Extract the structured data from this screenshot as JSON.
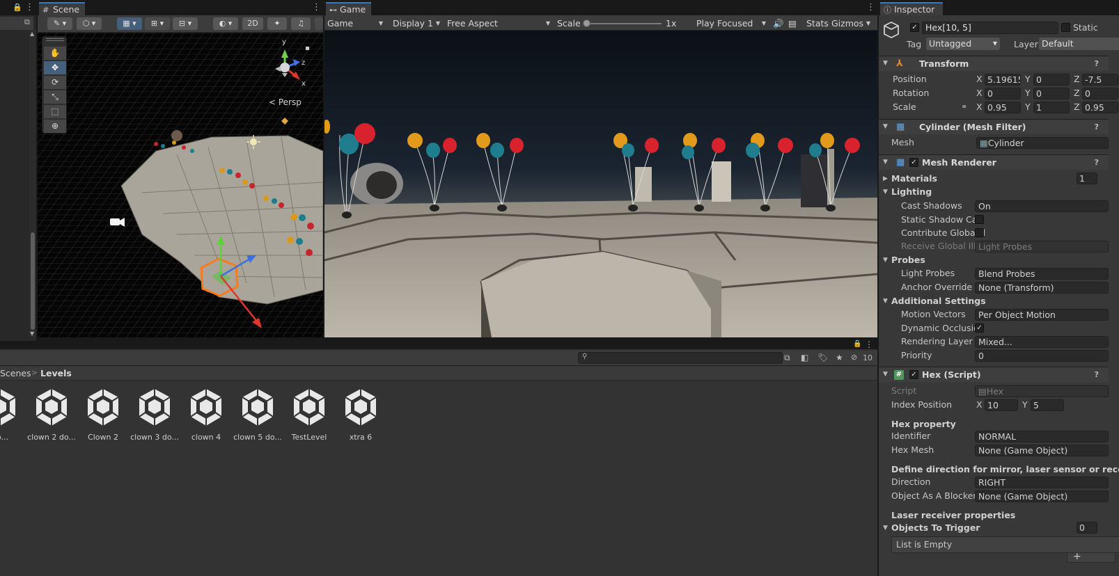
{
  "scene_tab": {
    "label": "Scene"
  },
  "game_tab": {
    "label": "Game"
  },
  "inspector_tab": {
    "label": "Inspector"
  },
  "scene_toolbar": {
    "mode_2d": "2D",
    "persp_label": "< Persp"
  },
  "gizmo_axes": {
    "x": "x",
    "y": "y",
    "z": "z"
  },
  "game_toolbar": {
    "display_mode": "Game",
    "display": "Display 1",
    "aspect": "Free Aspect",
    "scale_label": "Scale",
    "scale_value": "1x",
    "scale_fraction": 0.0,
    "play_mode": "Play Focused",
    "stats": "Stats",
    "gizmos": "Gizmos"
  },
  "project": {
    "breadcrumb": {
      "parent": "Scenes",
      "sep": ">",
      "current": "Levels"
    },
    "hidden_count": "10",
    "assets": [
      {
        "name": "do..."
      },
      {
        "name": "clown 2 do..."
      },
      {
        "name": "Clown 2"
      },
      {
        "name": "clown 3 do..."
      },
      {
        "name": "clown 4"
      },
      {
        "name": "clown 5 do..."
      },
      {
        "name": "TestLevel"
      },
      {
        "name": "xtra 6"
      }
    ]
  },
  "inspector": {
    "object_name": "Hex[10, 5]",
    "static_label": "Static",
    "tag_label": "Tag",
    "tag_value": "Untagged",
    "layer_label": "Layer",
    "layer_value": "Default",
    "transform": {
      "title": "Transform",
      "position": {
        "label": "Position",
        "x": "5.19615",
        "y": "0",
        "z": "-7.5"
      },
      "rotation": {
        "label": "Rotation",
        "x": "0",
        "y": "0",
        "z": "0"
      },
      "scale": {
        "label": "Scale",
        "x": "0.95",
        "y": "1",
        "z": "0.95"
      }
    },
    "mesh_filter": {
      "title": "Cylinder (Mesh Filter)",
      "mesh_label": "Mesh",
      "mesh_value": "Cylinder"
    },
    "mesh_renderer": {
      "title": "Mesh Renderer",
      "materials_label": "Materials",
      "materials_count": "1",
      "lighting_label": "Lighting",
      "cast_shadows_label": "Cast Shadows",
      "cast_shadows_value": "On",
      "static_shadow_label": "Static Shadow Cas",
      "contribute_gi_label": "Contribute Global Il",
      "receive_gi_label": "Receive Global Illu",
      "receive_gi_value": "Light Probes",
      "probes_label": "Probes",
      "light_probes_label": "Light Probes",
      "light_probes_value": "Blend Probes",
      "anchor_label": "Anchor Override",
      "anchor_value": "None (Transform)",
      "additional_label": "Additional Settings",
      "motion_label": "Motion Vectors",
      "motion_value": "Per Object Motion",
      "dynamic_occ_label": "Dynamic Occlusior",
      "rendering_layer_label": "Rendering Layer M",
      "rendering_layer_value": "Mixed...",
      "priority_label": "Priority",
      "priority_value": "0"
    },
    "hex_script": {
      "title": "Hex (Script)",
      "script_label": "Script",
      "script_value": "Hex",
      "index_label": "Index Position",
      "index_x": "10",
      "index_y": "5",
      "hex_property_header": "Hex property",
      "identifier_label": "Identifier",
      "identifier_value": "NORMAL",
      "hex_mesh_label": "Hex Mesh",
      "hex_mesh_value": "None (Game Object)",
      "direction_header": "Define direction for mirror, laser sensor or receiver",
      "direction_label": "Direction",
      "direction_value": "RIGHT",
      "blocker_label": "Object As A Blocker C",
      "blocker_value": "None (Game Object)",
      "receiver_header": "Laser receiver properties",
      "objects_label": "Objects To Trigger",
      "objects_count": "0",
      "list_empty": "List is Empty"
    }
  },
  "colors": {
    "accent": "#3a79bb",
    "panel": "#383838",
    "field": "#2a2a2a",
    "selection_outline": "#ff7a1a"
  }
}
